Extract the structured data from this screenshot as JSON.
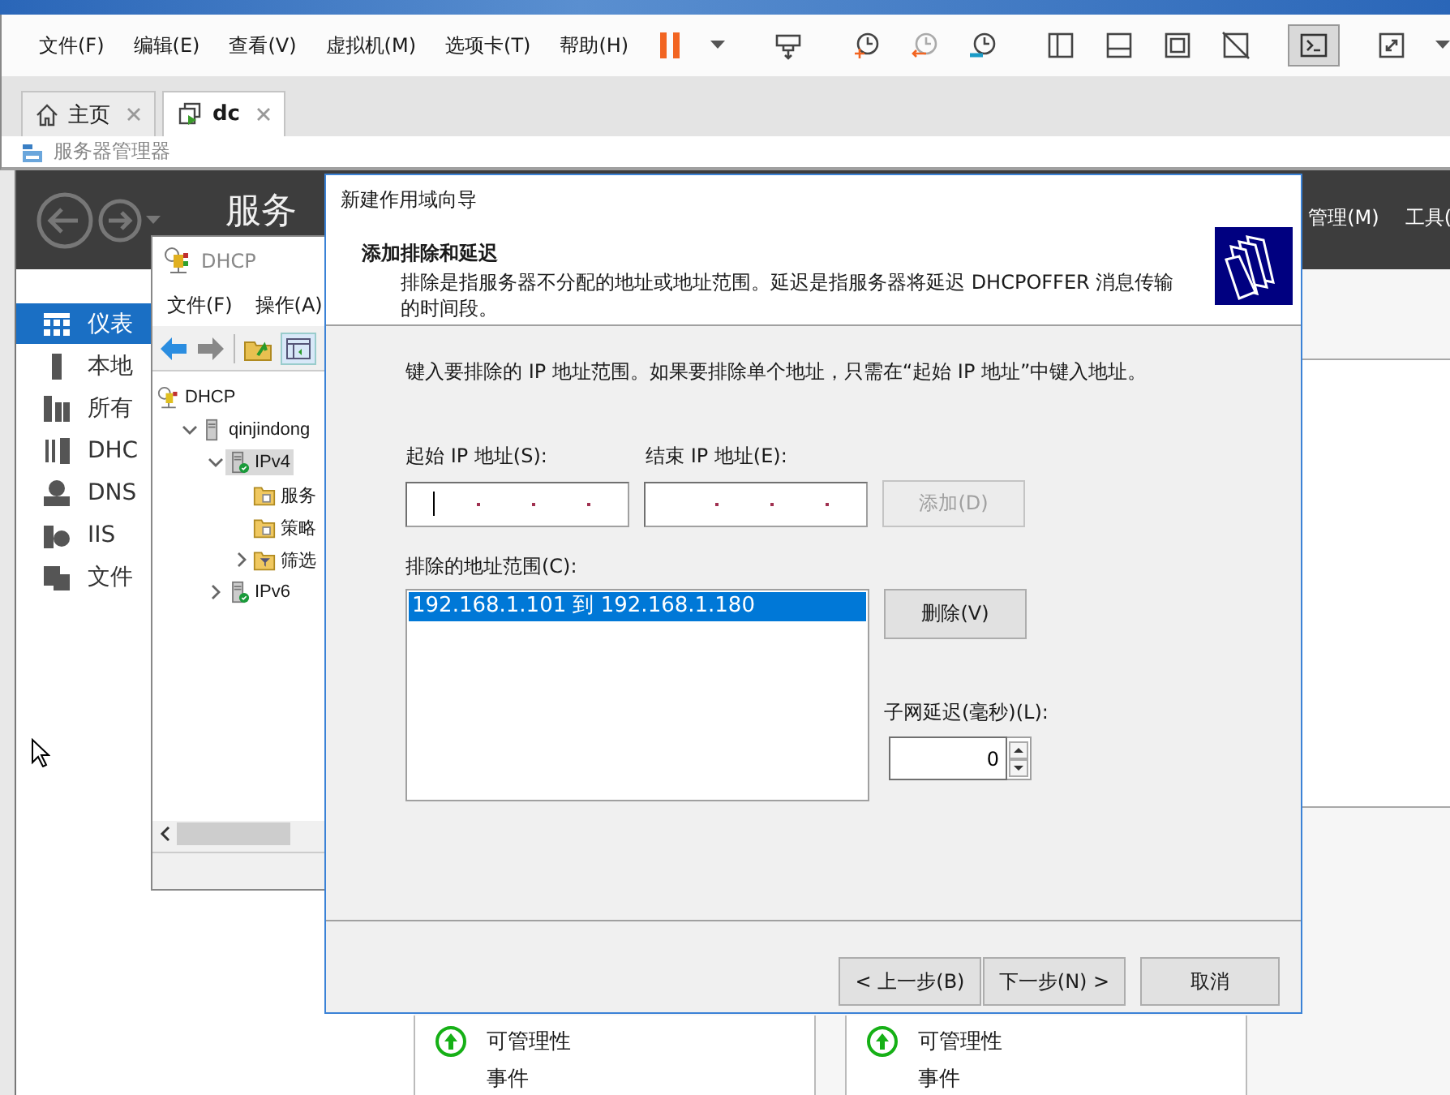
{
  "vmware": {
    "menu": [
      "文件(F)",
      "编辑(E)",
      "查看(V)",
      "虚拟机(M)",
      "选项卡(T)",
      "帮助(H)"
    ],
    "toolbar": [
      {
        "kind": "pause",
        "selected": false
      },
      {
        "kind": "caret",
        "selected": false
      },
      {
        "kind": "sep"
      },
      {
        "kind": "send",
        "selected": false
      },
      {
        "kind": "sep"
      },
      {
        "kind": "snap",
        "selected": false
      },
      {
        "kind": "revert",
        "selected": false
      },
      {
        "kind": "manage",
        "selected": false
      },
      {
        "kind": "sep"
      },
      {
        "kind": "library",
        "selected": false
      },
      {
        "kind": "thumbs",
        "selected": false
      },
      {
        "kind": "full",
        "selected": false
      },
      {
        "kind": "unity",
        "selected": false
      },
      {
        "kind": "sep"
      },
      {
        "kind": "console",
        "selected": true
      },
      {
        "kind": "sep"
      },
      {
        "kind": "stretch",
        "selected": false
      },
      {
        "kind": "caret",
        "selected": false
      }
    ],
    "tabs": [
      {
        "label": "主页",
        "kind": "home",
        "selected": false
      },
      {
        "label": "dc",
        "kind": "vm",
        "selected": true
      }
    ],
    "vm_title": "服务器管理器"
  },
  "server_manager": {
    "title": "服务",
    "menu": [
      "管理(M)",
      "工具("
    ],
    "sidebar": [
      {
        "label": "仪表",
        "kind": "dashboard",
        "selected": true
      },
      {
        "label": "本地",
        "kind": "local",
        "selected": false
      },
      {
        "label": "所有",
        "kind": "all",
        "selected": false
      },
      {
        "label": "DHC",
        "kind": "dhcp",
        "selected": false
      },
      {
        "label": "DNS",
        "kind": "dns",
        "selected": false
      },
      {
        "label": "IIS",
        "kind": "iis",
        "selected": false
      },
      {
        "label": "文件",
        "kind": "files",
        "selected": false
      }
    ],
    "tiles": [
      {
        "status": "可管理性",
        "row_2": "事件"
      },
      {
        "status": "可管理性",
        "row_2": "事件"
      }
    ]
  },
  "dhcp_console": {
    "title": "DHCP",
    "menu": [
      "文件(F)",
      "操作(A)"
    ],
    "tree": [
      {
        "label": "DHCP",
        "kind": "dhcp",
        "selected": false,
        "children": [
          {
            "label": "qinjindong",
            "kind": "server",
            "selected": false,
            "expanded": true,
            "children": [
              {
                "label": "IPv4",
                "kind": "ip",
                "selected": true,
                "expanded": true,
                "children": [
                  {
                    "label": "服务",
                    "kind": "folder",
                    "selected": false
                  },
                  {
                    "label": "策略",
                    "kind": "folder",
                    "selected": false
                  },
                  {
                    "label": "筛选",
                    "kind": "filter",
                    "selected": false,
                    "expanded": false
                  }
                ]
              },
              {
                "label": "IPv6",
                "kind": "ip",
                "selected": false,
                "expanded": false
              }
            ]
          }
        ]
      }
    ]
  },
  "wizard": {
    "title": "新建作用域向导",
    "heading": "添加排除和延迟",
    "description": "排除是指服务器不分配的地址或地址范围。延迟是指服务器将延迟 DHCPOFFER 消息传输的时间段。",
    "instruction": "键入要排除的 IP 地址范围。如果要排除单个地址，只需在“起始 IP 地址”中键入地址。",
    "start_field": {
      "label": "起始 IP 地址(S):",
      "focused": true
    },
    "end_field": {
      "label": "结束 IP 地址(E):",
      "focused": false
    },
    "add_button": {
      "label": "添加(D)",
      "disabled": true
    },
    "list_label": "排除的地址范围(C):",
    "ranges": [
      {
        "text": "192.168.1.101 到 192.168.1.180",
        "selected": true
      }
    ],
    "remove_button": {
      "label": "删除(V)",
      "disabled": false
    },
    "delay_label": "子网延迟(毫秒)(L):",
    "delay_value": "0",
    "buttons": [
      {
        "label": "< 上一步(B)",
        "kind": "back"
      },
      {
        "label": "下一步(N) >",
        "kind": "next"
      },
      {
        "label": "取消",
        "kind": "cancel"
      }
    ]
  }
}
